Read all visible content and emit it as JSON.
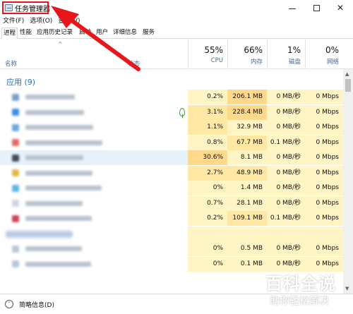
{
  "window": {
    "title": "任务管理器"
  },
  "menu": [
    {
      "label": "文件(F)"
    },
    {
      "label": "选项(O)"
    },
    {
      "label": "查看(V)"
    }
  ],
  "tabs": [
    {
      "label": "进程",
      "active": true
    },
    {
      "label": "性能"
    },
    {
      "label": "应用历史记录"
    },
    {
      "label": "启动"
    },
    {
      "label": "用户"
    },
    {
      "label": "详细信息"
    },
    {
      "label": "服务"
    }
  ],
  "columns": {
    "name": "名称",
    "status": "状态",
    "cpu": {
      "percent": "55%",
      "label": "CPU"
    },
    "memory": {
      "percent": "66%",
      "label": "内存"
    },
    "disk": {
      "percent": "1%",
      "label": "磁盘"
    },
    "network": {
      "percent": "0%",
      "label": "网络"
    }
  },
  "section": {
    "title": "应用 (9)"
  },
  "rows": [
    {
      "cpu": "0.2%",
      "memory": "206.1 MB",
      "disk": "0 MB/秒",
      "network": "0 Mbps",
      "icon_color": "#7a9fc9"
    },
    {
      "cpu": "3.1%",
      "memory": "228.4 MB",
      "disk": "0 MB/秒",
      "network": "0 Mbps",
      "icon_color": "#3d8ee0",
      "eco": true
    },
    {
      "cpu": "1.1%",
      "memory": "32.9 MB",
      "disk": "0 MB/秒",
      "network": "0 Mbps",
      "icon_color": "#6fa6dd"
    },
    {
      "cpu": "0.8%",
      "memory": "67.7 MB",
      "disk": "0.1 MB/秒",
      "network": "0 Mbps",
      "icon_color": "#e06a6a"
    },
    {
      "cpu": "30.6%",
      "memory": "8.1 MB",
      "disk": "0 MB/秒",
      "network": "0 Mbps",
      "icon_color": "#444a55",
      "selected": true
    },
    {
      "cpu": "2.7%",
      "memory": "48.9 MB",
      "disk": "0 MB/秒",
      "network": "0 Mbps",
      "icon_color": "#e0b84a"
    },
    {
      "cpu": "0%",
      "memory": "1.4 MB",
      "disk": "0 MB/秒",
      "network": "0 Mbps",
      "icon_color": "#5fb7e6"
    },
    {
      "cpu": "0.7%",
      "memory": "28.1 MB",
      "disk": "0 MB/秒",
      "network": "0 Mbps",
      "icon_color": "#cfd6de"
    },
    {
      "cpu": "0.2%",
      "memory": "109.1 MB",
      "disk": "0.1 MB/秒",
      "network": "0 Mbps",
      "icon_color": "#c9485a"
    },
    {
      "cpu": "",
      "memory": "",
      "disk": "",
      "network": "",
      "group": true
    },
    {
      "cpu": "0%",
      "memory": "0.5 MB",
      "disk": "0 MB/秒",
      "network": "0 Mbps",
      "icon_color": "#b9c7d8"
    },
    {
      "cpu": "0%",
      "memory": "0.1 MB",
      "disk": "0 MB/秒",
      "network": "0 Mbps",
      "icon_color": "#b9c7d8"
    }
  ],
  "footer": {
    "label": "简略信息(D)"
  },
  "watermark": {
    "title": "百科全说",
    "subtitle": "助你轻松解决"
  },
  "colors": {
    "accent": "#2e6fbf",
    "highlight_box": "#e8161b",
    "selected_row": "#e5f1fb",
    "heat_light": "#fff4c4",
    "heat_mid": "#ffe8a3",
    "heat_high": "#ffd88a"
  }
}
